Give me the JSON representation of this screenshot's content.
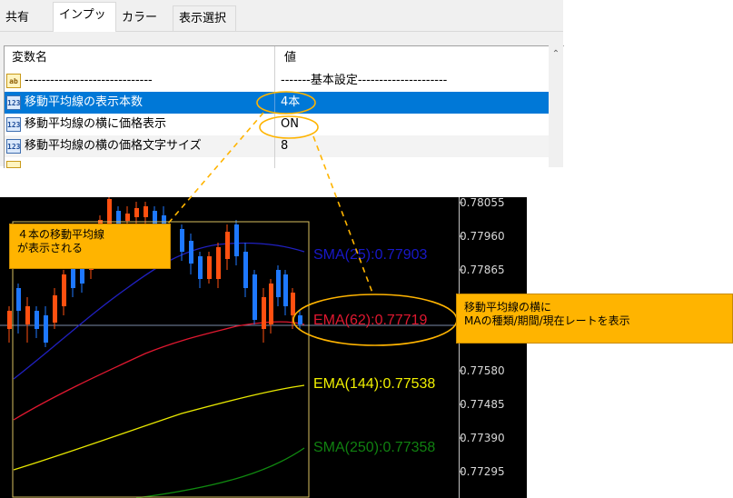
{
  "tabs": [
    {
      "label": "共有"
    },
    {
      "label": "インプット"
    },
    {
      "label": "カラー"
    },
    {
      "label": "表示選択"
    }
  ],
  "grid": {
    "header": {
      "name": "変数名",
      "value": "値"
    },
    "rows": [
      {
        "icon": "ab",
        "name": "------------------------------",
        "value": "-------基本設定---------------------"
      },
      {
        "icon": "123",
        "name": "移動平均線の表示本数",
        "value": "4本"
      },
      {
        "icon": "123",
        "name": "移動平均線の横に価格表示",
        "value": "ON"
      },
      {
        "icon": "123",
        "name": "移動平均線の横の価格文字サイズ",
        "value": "8"
      }
    ]
  },
  "chart": {
    "price_ticks": [
      "0.78055",
      "0.77960",
      "0.77865",
      "0.77580",
      "0.77485",
      "0.77390",
      "0.77295"
    ],
    "ma_labels": [
      {
        "text": "SMA(25):0.77903",
        "color": "#1818c8"
      },
      {
        "text": "EMA(62):0.77719",
        "color": "#e01830"
      },
      {
        "text": "EMA(144):0.77538",
        "color": "#f0f000"
      },
      {
        "text": "SMA(250):0.77358",
        "color": "#108010"
      }
    ]
  },
  "notes": {
    "left": [
      "４本の移動平均線",
      "が表示される"
    ],
    "right": [
      "移動平均線の横に",
      "MAの種類/期間/現在レートを表示"
    ]
  },
  "colors": {
    "accent": "#ffb400",
    "selected_row": "#0078d7"
  }
}
